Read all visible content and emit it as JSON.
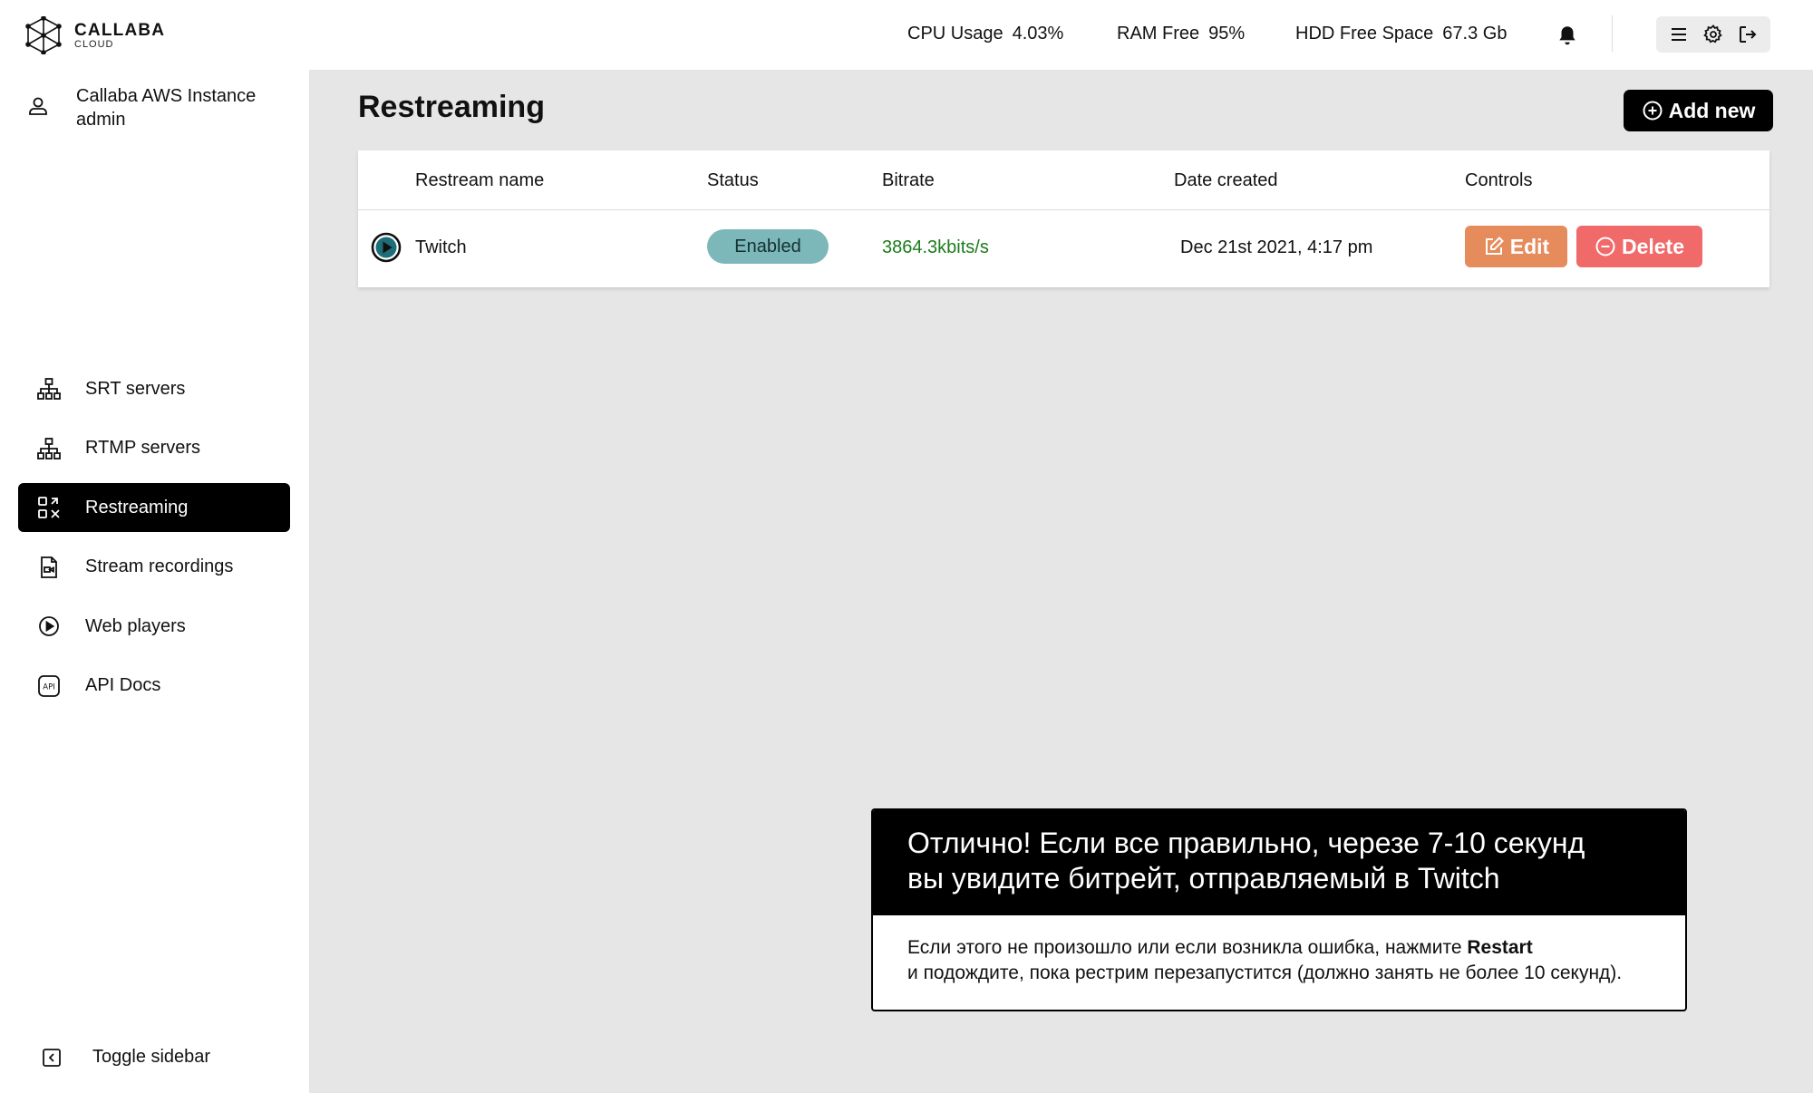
{
  "brand": {
    "name": "CALLABA",
    "sub": "CLOUD"
  },
  "account": {
    "instance": "Callaba AWS Instance",
    "user": "admin"
  },
  "sidebar": {
    "items": [
      {
        "label": "SRT servers",
        "icon": "network-icon",
        "active": false
      },
      {
        "label": "RTMP servers",
        "icon": "network-icon",
        "active": false
      },
      {
        "label": "Restreaming",
        "icon": "restream-icon",
        "active": true
      },
      {
        "label": "Stream recordings",
        "icon": "file-video-icon",
        "active": false
      },
      {
        "label": "Web players",
        "icon": "play-circle-icon",
        "active": false
      },
      {
        "label": "API Docs",
        "icon": "api-icon",
        "active": false
      }
    ],
    "toggle_label": "Toggle sidebar"
  },
  "topbar": {
    "cpu_label": "CPU Usage",
    "cpu_value": "4.03%",
    "ram_label": "RAM Free",
    "ram_value": "95%",
    "hdd_label": "HDD Free Space",
    "hdd_value": "67.3 Gb"
  },
  "page": {
    "title": "Restreaming",
    "add_label": "Add new"
  },
  "table": {
    "headers": [
      "Restream name",
      "Status",
      "Bitrate",
      "Date created",
      "Controls"
    ],
    "rows": [
      {
        "name": "Twitch",
        "status": "Enabled",
        "bitrate": "3864.3kbits/s",
        "date": "Dec 21st 2021, 4:17 pm",
        "edit_label": "Edit",
        "delete_label": "Delete"
      }
    ]
  },
  "tooltip": {
    "title_line1": "Отлично! Если все правильно, черезе 7-10 секунд",
    "title_line2": "вы увидите битрейт, отправляемый в Twitch",
    "body_prefix": "Если этого не произошло или если возникла ошибка, нажмите ",
    "body_bold": "Restart",
    "body_line2": "и подождите, пока рестрим перезапустится (должно занять не более 10 секунд)."
  },
  "colors": {
    "active_nav": "#000000",
    "status_badge": "#7cb7b9",
    "bitrate_text": "#1a7c1a",
    "edit_button": "#e58b5c",
    "delete_button": "#f06a6a",
    "background": "#e6e6e6"
  }
}
